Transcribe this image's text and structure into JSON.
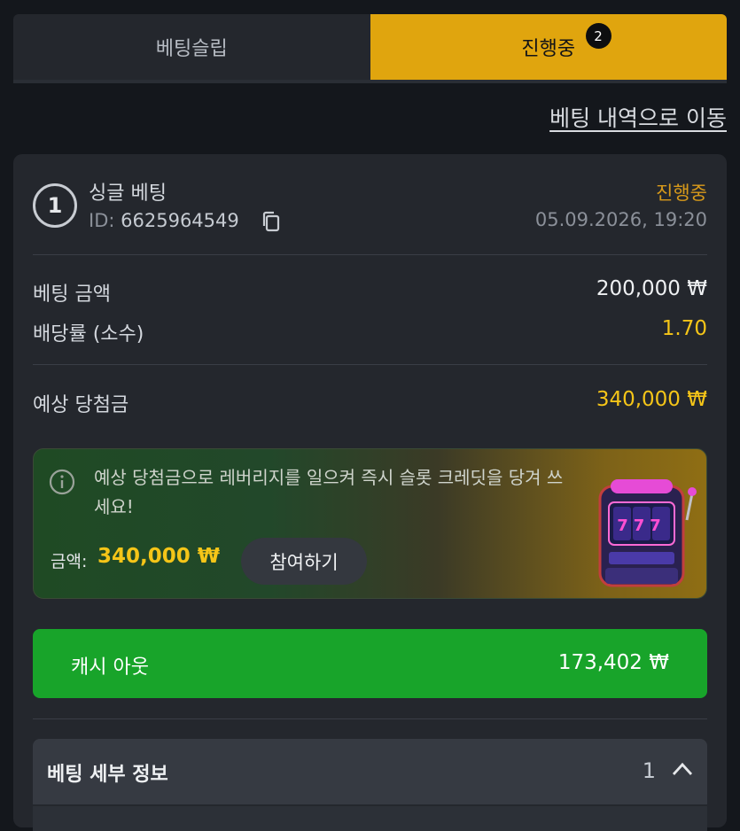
{
  "tabs": [
    {
      "label": "베팅슬립",
      "active": false
    },
    {
      "label": "진행중",
      "active": true,
      "badge": "2"
    }
  ],
  "history_link": "베팅 내역으로 이동",
  "bet": {
    "index": "1",
    "type": "싱글 베팅",
    "id_label": "ID:",
    "id_value": "6625964549",
    "status": "진행중",
    "datetime": "05.09.2026, 19:20",
    "stake_label": "베팅 금액",
    "stake_value": "200,000 ₩",
    "odds_label": "배당률 (소수)",
    "odds_value": "1.70",
    "payout_label": "예상 당첨금",
    "payout_value": "340,000 ₩"
  },
  "promo": {
    "text": "예상 당첨금으로 레버리지를 일으켜 즉시 슬롯 크레딧을 당겨 쓰세요!",
    "amount_label": "금액:",
    "amount_value": "340,000 ₩",
    "join_label": "참여하기",
    "slot_digits": "777"
  },
  "cashout": {
    "label": "캐시 아웃",
    "value": "173,402 ₩"
  },
  "details": {
    "label": "베팅 세부 정보",
    "count": "1"
  },
  "colors": {
    "accent_gold": "#e0a50e",
    "status_orange": "#d89a1a",
    "value_yellow": "#f5c518",
    "cashout_green": "#18a42a"
  }
}
